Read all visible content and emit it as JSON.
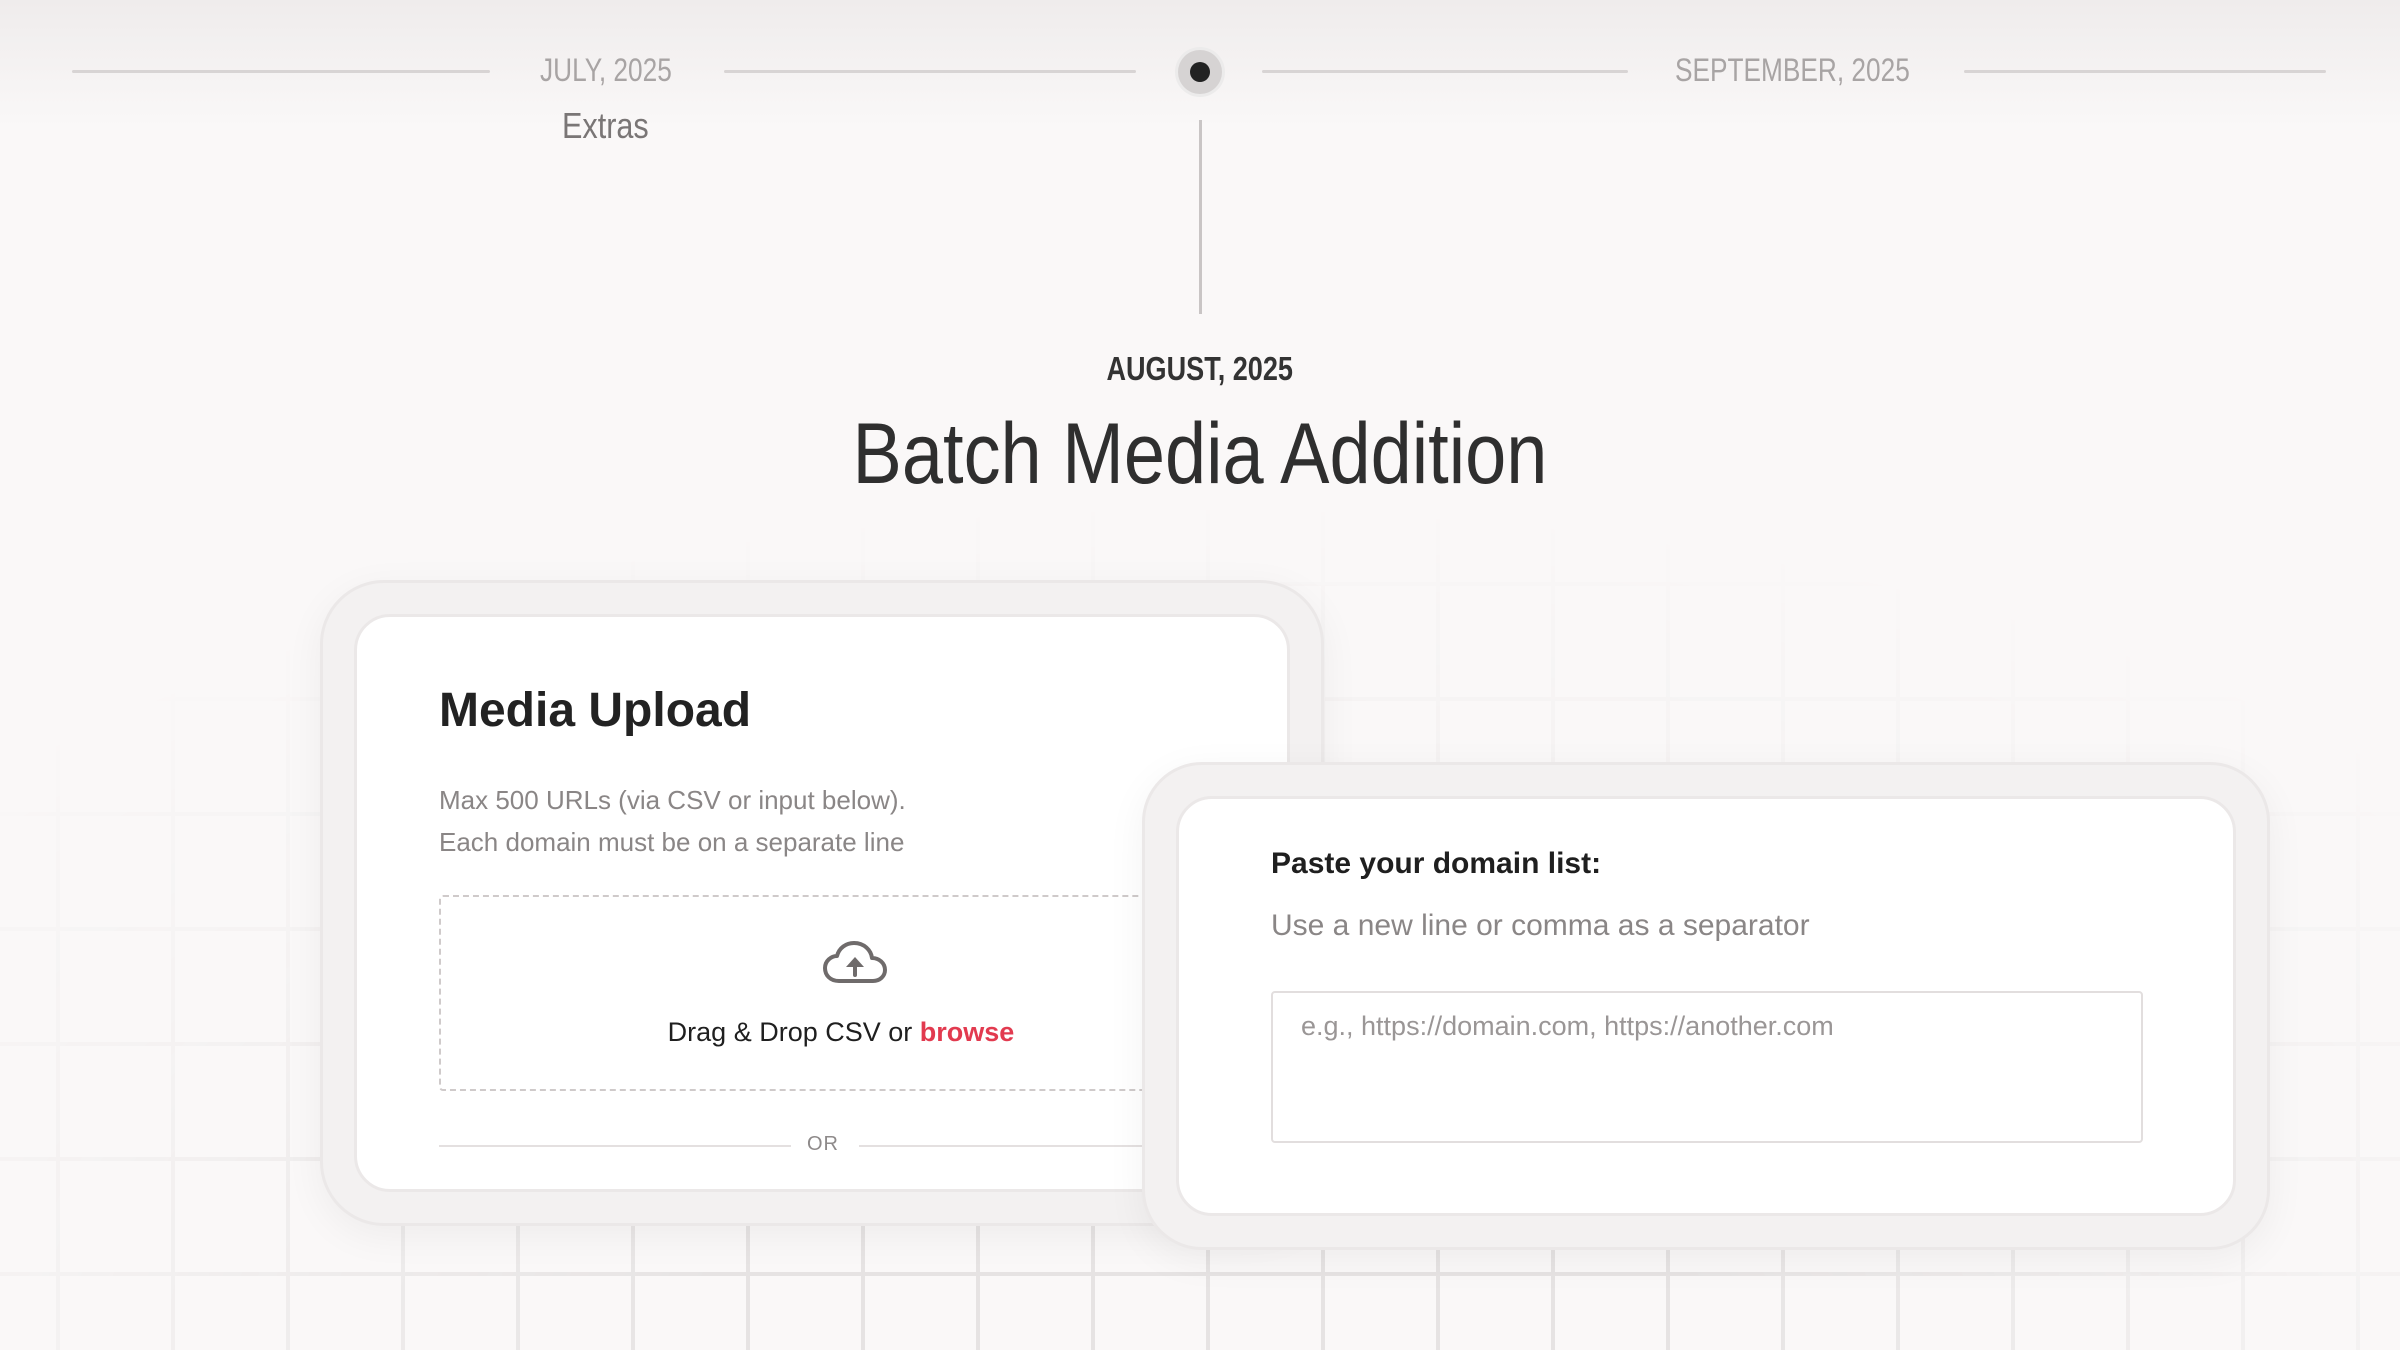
{
  "timeline": {
    "prev": {
      "date": "JULY, 2025",
      "label": "Extras"
    },
    "current": {
      "date": "AUGUST, 2025",
      "title": "Batch Media Addition"
    },
    "next": {
      "date": "SEPTEMBER, 2025"
    }
  },
  "media_upload": {
    "title": "Media Upload",
    "description_line1": "Max 500 URLs (via CSV or input below).",
    "description_line2": "Each domain must be on a separate line",
    "drop_text": "Drag & Drop CSV or",
    "browse_label": "browse",
    "divider_label": "OR",
    "icon": "cloud-upload-icon"
  },
  "domain_list": {
    "title": "Paste your domain list:",
    "subtitle": "Use a new line or comma as a separator",
    "placeholder": "e.g., https://domain.com, https://another.com",
    "value": ""
  },
  "colors": {
    "accent": "#e23a4f",
    "background": "#faf8f8",
    "card": "#ffffff"
  }
}
